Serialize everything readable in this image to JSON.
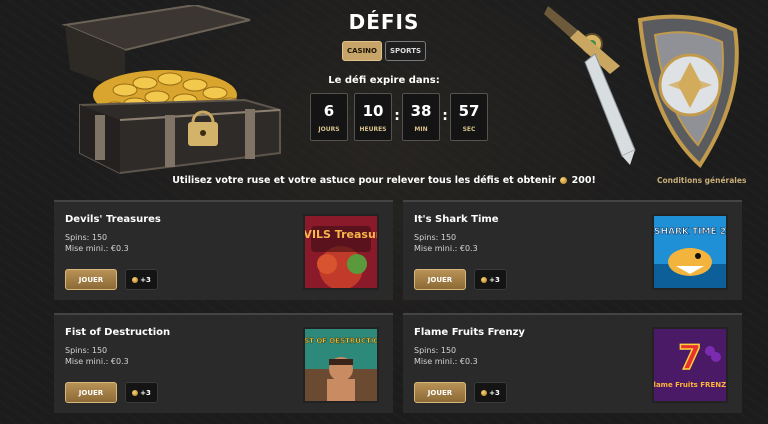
{
  "header": {
    "title": "DÉFIS",
    "tabs": [
      {
        "label": "CASINO",
        "active": true
      },
      {
        "label": "SPORTS",
        "active": false
      }
    ]
  },
  "countdown": {
    "label": "Le défi expire dans:",
    "days": {
      "value": "6",
      "unit": "JOURS"
    },
    "hours": {
      "value": "10",
      "unit": "HEURES"
    },
    "minutes": {
      "value": "38",
      "unit": "MIN"
    },
    "seconds": {
      "value": "57",
      "unit": "SEC"
    }
  },
  "intro": {
    "text": "Utilisez votre ruse et votre astuce pour relever tous les défis et obtenir",
    "reward": "200!"
  },
  "conditions_link": "Conditions générales",
  "challenges": [
    {
      "name": "Devils' Treasures",
      "spins": "Spins: 150",
      "min_bet": "Mise mini.: €0.3",
      "button": "JOUER",
      "bonus": "+3",
      "thumb_text": "DEVILS Treasures"
    },
    {
      "name": "It's Shark Time",
      "spins": "Spins: 150",
      "min_bet": "Mise mini.: €0.3",
      "button": "JOUER",
      "bonus": "+3",
      "thumb_text": "SHARK TIME 2"
    },
    {
      "name": "Fist of Destruction",
      "spins": "Spins: 150",
      "min_bet": "Mise mini.: €0.3",
      "button": "JOUER",
      "bonus": "+3",
      "thumb_text": "FIST OF DESTRUCTION"
    },
    {
      "name": "Flame Fruits Frenzy",
      "spins": "Spins: 150",
      "min_bet": "Mise mini.: €0.3",
      "button": "JOUER",
      "bonus": "+3",
      "thumb_text": "Flame Fruits FRENZY"
    }
  ],
  "colors": {
    "accent_gold": "#c7a56a",
    "background": "#1c1c1d",
    "card": "#2b2a2b"
  }
}
